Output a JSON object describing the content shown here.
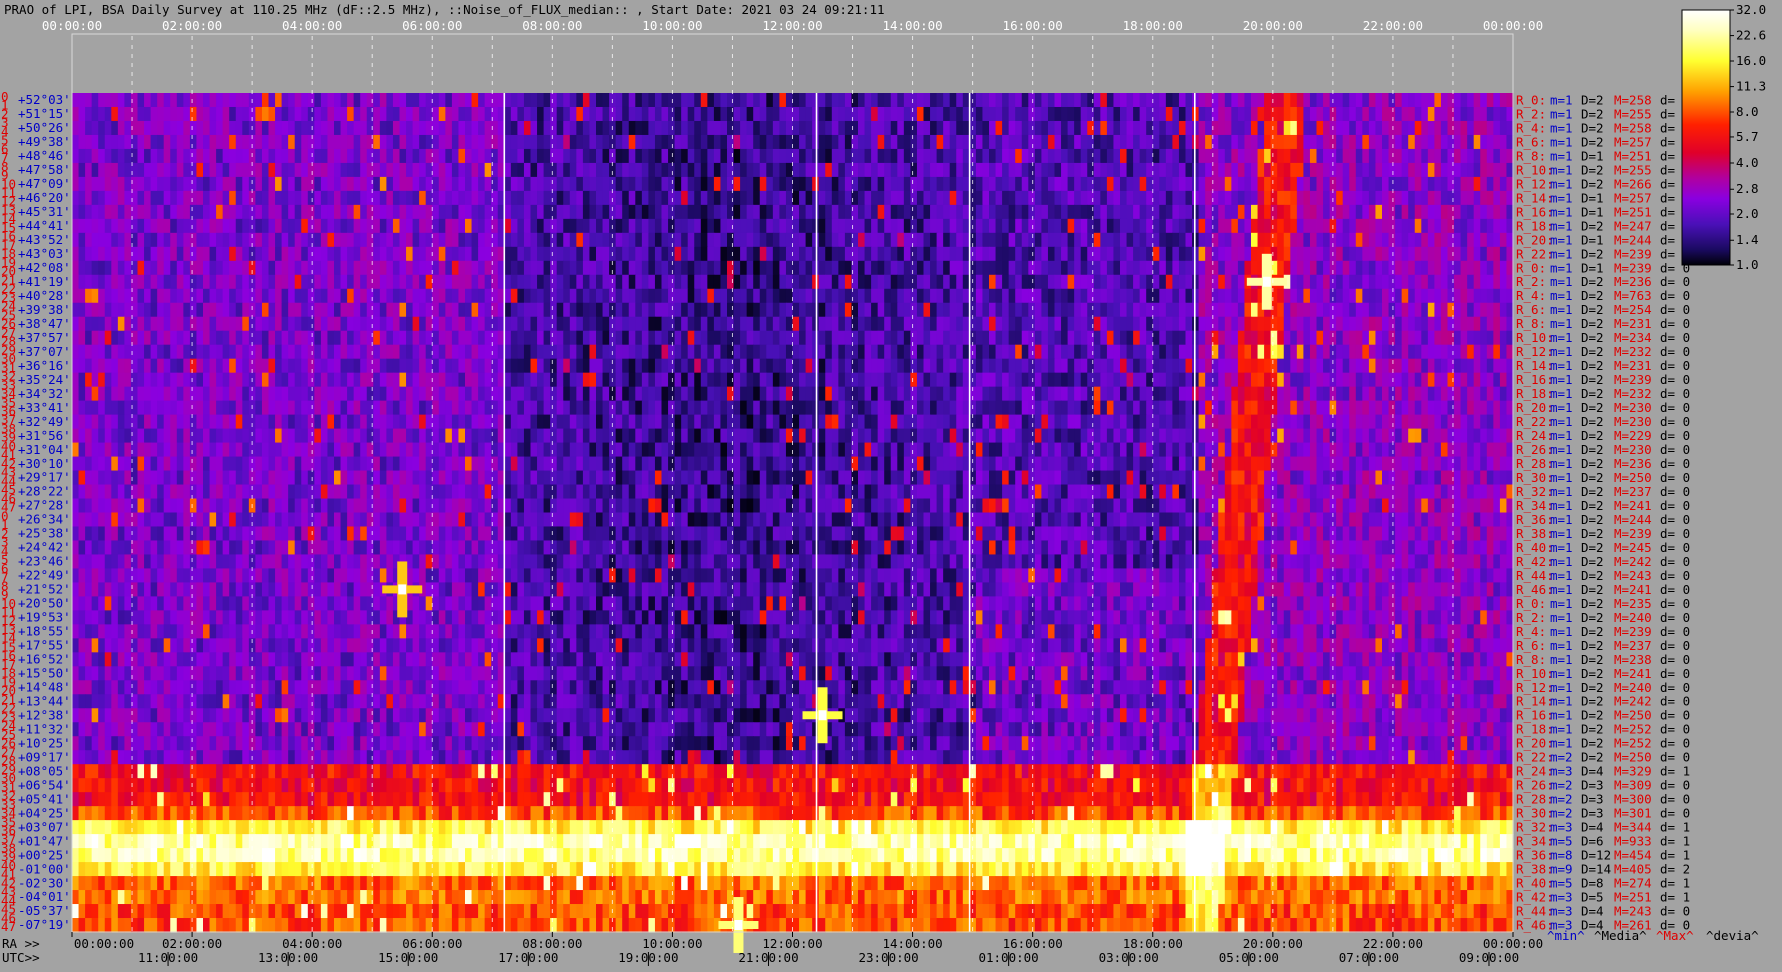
{
  "title": "PRAO of LPI, BSA Daily Survey at 110.25 MHz (dF::2.5 MHz), ::Noise_of_FLUX_median:: , Start Date: 2021 03 24 09:21:11",
  "colors": {
    "background": "#a3a3a3",
    "row_labels": "#e00000",
    "stat_values": "#0000c8",
    "text": "#000000",
    "guide": "#ffffff"
  },
  "chart_data": {
    "type": "heatmap",
    "title": "PRAO of LPI, BSA Daily Survey at 110.25 MHz (dF::2.5 MHz), ::Noise_of_FLUX_median:: , Start Date: 2021 03 24 09:21:11",
    "top_axis_ticks": [
      "00:00:00",
      "02:00:00",
      "04:00:00",
      "06:00:00",
      "08:00:00",
      "10:00:00",
      "12:00:00",
      "14:00:00",
      "16:00:00",
      "18:00:00",
      "20:00:00",
      "22:00:00",
      "00:00:00"
    ],
    "bottom_axis": {
      "ra_label": "RA >>",
      "ra_ticks": [
        "00:00:00",
        "02:00:00",
        "04:00:00",
        "06:00:00",
        "08:00:00",
        "10:00:00",
        "12:00:00",
        "14:00:00",
        "16:00:00",
        "18:00:00",
        "20:00:00",
        "22:00:00",
        "00:00:00"
      ],
      "utc_label": "UTC>>",
      "utc_ticks": [
        "11:00:00",
        "13:00:00",
        "15:00:00",
        "17:00:00",
        "19:00:00",
        "21:00:00",
        "23:00:00",
        "01:00:00",
        "03:00:00",
        "05:00:00",
        "07:00:00",
        "09:00:00"
      ]
    },
    "ra_range_hours": [
      0,
      24
    ],
    "declination_labels": [
      "+52°03'",
      "+51°15'",
      "+50°26'",
      "+49°38'",
      "+48°46'",
      "+47°58'",
      "+47°09'",
      "+46°20'",
      "+45°31'",
      "+44°41'",
      "+43°52'",
      "+43°03'",
      "+42°08'",
      "+41°19'",
      "+40°28'",
      "+39°38'",
      "+38°47'",
      "+37°57'",
      "+37°07'",
      "+36°16'",
      "+35°24'",
      "+34°32'",
      "+33°41'",
      "+32°49'",
      "+31°56'",
      "+31°04'",
      "+30°10'",
      "+29°17'",
      "+28°22'",
      "+27°28'",
      "+26°34'",
      "+25°38'",
      "+24°42'",
      "+23°46'",
      "+22°49'",
      "+21°52'",
      "+20°50'",
      "+19°53'",
      "+18°55'",
      "+17°55'",
      "+16°52'",
      "+15°50'",
      "+14°48'",
      "+13°44'",
      "+12°38'",
      "+11°32'",
      "+10°25'",
      "+09°17'",
      "+08°05'",
      "+06°54'",
      "+05°41'",
      "+04°25'",
      "+03°07'",
      "+01°47'",
      "+00°25'",
      "-01°00'",
      "-02°30'",
      "-04°01'",
      "-05°37'",
      "-07°19'"
    ],
    "row_index_labels": [
      "0",
      "1",
      "2",
      "3",
      "4",
      "5",
      "6",
      "7",
      "8",
      "9",
      "10",
      "11",
      "12",
      "13",
      "14",
      "15",
      "16",
      "17",
      "18",
      "19",
      "20",
      "21",
      "22",
      "23",
      "24",
      "25",
      "26",
      "27",
      "28",
      "29",
      "30",
      "31",
      "32",
      "33",
      "34",
      "35",
      "36",
      "37",
      "38",
      "39",
      "40",
      "41",
      "42",
      "43",
      "44",
      "45",
      "46",
      "47",
      "0",
      "1",
      "2",
      "3",
      "4",
      "5",
      "6",
      "7",
      "8",
      "9",
      "10",
      "11",
      "12",
      "13",
      "14",
      "15",
      "16",
      "17",
      "18",
      "19",
      "20",
      "21",
      "22",
      "23",
      "24",
      "25",
      "26",
      "27",
      "28",
      "29",
      "30",
      "31",
      "32",
      "33",
      "34",
      "35",
      "36",
      "37",
      "38",
      "39",
      "40",
      "41",
      "42",
      "43",
      "44",
      "45",
      "46",
      "47"
    ],
    "colorbar": {
      "ticks": [
        32.0,
        22.6,
        16.0,
        11.3,
        8.0,
        5.7,
        4.0,
        2.8,
        2.0,
        1.4,
        1.0
      ],
      "tick_labels": [
        "32.0",
        "22.6",
        "16.0",
        "11.3",
        "8.0",
        "5.7",
        "4.0",
        "2.8",
        "2.0",
        "1.4",
        "1.0"
      ],
      "scale": "log",
      "range": [
        1.0,
        32.0
      ]
    },
    "stats_legend": [
      "^min^",
      "^Media^",
      "^Max^",
      "^devia^"
    ],
    "stats_rows": [
      {
        "r": "R_0:",
        "m": "m=1",
        "d": "D=2",
        "M": "M=258",
        "dv": "d= 0"
      },
      {
        "r": "R_2:",
        "m": "m=1",
        "d": "D=2",
        "M": "M=255",
        "dv": "d= 0"
      },
      {
        "r": "R_4:",
        "m": "m=1",
        "d": "D=2",
        "M": "M=258",
        "dv": "d= 0"
      },
      {
        "r": "R_6:",
        "m": "m=1",
        "d": "D=2",
        "M": "M=257",
        "dv": "d= 0"
      },
      {
        "r": "R_8:",
        "m": "m=1",
        "d": "D=1",
        "M": "M=251",
        "dv": "d= 0"
      },
      {
        "r": "R_10:",
        "m": "m=1",
        "d": "D=2",
        "M": "M=255",
        "dv": "d="
      },
      {
        "r": "R_12:",
        "m": "m=1",
        "d": "D=2",
        "M": "M=266",
        "dv": "d="
      },
      {
        "r": "R_14:",
        "m": "m=1",
        "d": "D=1",
        "M": "M=257",
        "dv": "d="
      },
      {
        "r": "R_16:",
        "m": "m=1",
        "d": "D=1",
        "M": "M=251",
        "dv": "d="
      },
      {
        "r": "R_18:",
        "m": "m=1",
        "d": "D=2",
        "M": "M=247",
        "dv": "d="
      },
      {
        "r": "R_20:",
        "m": "m=1",
        "d": "D=1",
        "M": "M=244",
        "dv": "d="
      },
      {
        "r": "R_22:",
        "m": "m=1",
        "d": "D=2",
        "M": "M=239",
        "dv": "d="
      },
      {
        "r": "R_0:",
        "m": "m=1",
        "d": "D=1",
        "M": "M=239",
        "dv": "d= 0"
      },
      {
        "r": "R_2:",
        "m": "m=1",
        "d": "D=2",
        "M": "M=236",
        "dv": "d= 0"
      },
      {
        "r": "R_4:",
        "m": "m=1",
        "d": "D=2",
        "M": "M=763",
        "dv": "d= 0"
      },
      {
        "r": "R_6:",
        "m": "m=1",
        "d": "D=2",
        "M": "M=254",
        "dv": "d= 0"
      },
      {
        "r": "R_8:",
        "m": "m=1",
        "d": "D=2",
        "M": "M=231",
        "dv": "d= 0"
      },
      {
        "r": "R_10:",
        "m": "m=1",
        "d": "D=2",
        "M": "M=234",
        "dv": "d= 0"
      },
      {
        "r": "R_12:",
        "m": "m=1",
        "d": "D=2",
        "M": "M=232",
        "dv": "d= 0"
      },
      {
        "r": "R_14:",
        "m": "m=1",
        "d": "D=2",
        "M": "M=231",
        "dv": "d= 0"
      },
      {
        "r": "R_16:",
        "m": "m=1",
        "d": "D=2",
        "M": "M=239",
        "dv": "d= 0"
      },
      {
        "r": "R_18:",
        "m": "m=1",
        "d": "D=2",
        "M": "M=232",
        "dv": "d= 0"
      },
      {
        "r": "R_20:",
        "m": "m=1",
        "d": "D=2",
        "M": "M=230",
        "dv": "d= 0"
      },
      {
        "r": "R_22:",
        "m": "m=1",
        "d": "D=2",
        "M": "M=230",
        "dv": "d= 0"
      },
      {
        "r": "R_24:",
        "m": "m=1",
        "d": "D=2",
        "M": "M=229",
        "dv": "d= 0"
      },
      {
        "r": "R_26:",
        "m": "m=1",
        "d": "D=2",
        "M": "M=230",
        "dv": "d= 0"
      },
      {
        "r": "R_28:",
        "m": "m=1",
        "d": "D=2",
        "M": "M=236",
        "dv": "d= 0"
      },
      {
        "r": "R_30:",
        "m": "m=1",
        "d": "D=2",
        "M": "M=250",
        "dv": "d= 0"
      },
      {
        "r": "R_32:",
        "m": "m=1",
        "d": "D=2",
        "M": "M=237",
        "dv": "d= 0"
      },
      {
        "r": "R_34:",
        "m": "m=1",
        "d": "D=2",
        "M": "M=241",
        "dv": "d= 0"
      },
      {
        "r": "R_36:",
        "m": "m=1",
        "d": "D=2",
        "M": "M=244",
        "dv": "d= 0"
      },
      {
        "r": "R_38:",
        "m": "m=1",
        "d": "D=2",
        "M": "M=239",
        "dv": "d= 0"
      },
      {
        "r": "R_40:",
        "m": "m=1",
        "d": "D=2",
        "M": "M=245",
        "dv": "d= 0"
      },
      {
        "r": "R_42:",
        "m": "m=1",
        "d": "D=2",
        "M": "M=242",
        "dv": "d= 0"
      },
      {
        "r": "R_44:",
        "m": "m=1",
        "d": "D=2",
        "M": "M=243",
        "dv": "d= 0"
      },
      {
        "r": "R_46:",
        "m": "m=1",
        "d": "D=2",
        "M": "M=241",
        "dv": "d= 0"
      },
      {
        "r": "R_0:",
        "m": "m=1",
        "d": "D=2",
        "M": "M=235",
        "dv": "d= 0"
      },
      {
        "r": "R_2:",
        "m": "m=1",
        "d": "D=2",
        "M": "M=240",
        "dv": "d= 0"
      },
      {
        "r": "R_4:",
        "m": "m=1",
        "d": "D=2",
        "M": "M=239",
        "dv": "d= 0"
      },
      {
        "r": "R_6:",
        "m": "m=1",
        "d": "D=2",
        "M": "M=237",
        "dv": "d= 0"
      },
      {
        "r": "R_8:",
        "m": "m=1",
        "d": "D=2",
        "M": "M=238",
        "dv": "d= 0"
      },
      {
        "r": "R_10:",
        "m": "m=1",
        "d": "D=2",
        "M": "M=241",
        "dv": "d= 0"
      },
      {
        "r": "R_12:",
        "m": "m=1",
        "d": "D=2",
        "M": "M=240",
        "dv": "d= 0"
      },
      {
        "r": "R_14:",
        "m": "m=1",
        "d": "D=2",
        "M": "M=242",
        "dv": "d= 0"
      },
      {
        "r": "R_16:",
        "m": "m=1",
        "d": "D=2",
        "M": "M=250",
        "dv": "d= 0"
      },
      {
        "r": "R_18:",
        "m": "m=1",
        "d": "D=2",
        "M": "M=252",
        "dv": "d= 0"
      },
      {
        "r": "R_20:",
        "m": "m=1",
        "d": "D=2",
        "M": "M=252",
        "dv": "d= 0"
      },
      {
        "r": "R_22:",
        "m": "m=2",
        "d": "D=2",
        "M": "M=250",
        "dv": "d= 0"
      },
      {
        "r": "R_24:",
        "m": "m=3",
        "d": "D=4",
        "M": "M=329",
        "dv": "d= 1"
      },
      {
        "r": "R_26:",
        "m": "m=2",
        "d": "D=3",
        "M": "M=309",
        "dv": "d= 0"
      },
      {
        "r": "R_28:",
        "m": "m=2",
        "d": "D=3",
        "M": "M=300",
        "dv": "d= 0"
      },
      {
        "r": "R_30:",
        "m": "m=2",
        "d": "D=3",
        "M": "M=301",
        "dv": "d= 0"
      },
      {
        "r": "R_32:",
        "m": "m=3",
        "d": "D=4",
        "M": "M=344",
        "dv": "d= 1"
      },
      {
        "r": "R_34:",
        "m": "m=5",
        "d": "D=6",
        "M": "M=933",
        "dv": "d= 1"
      },
      {
        "r": "R_36:",
        "m": "m=8",
        "d": "D=12",
        "M": "M=454",
        "dv": "d= 1"
      },
      {
        "r": "R_38:",
        "m": "m=9",
        "d": "D=14",
        "M": "M=405",
        "dv": "d= 2"
      },
      {
        "r": "R_40:",
        "m": "m=5",
        "d": "D=8",
        "M": "M=274",
        "dv": "d= 1"
      },
      {
        "r": "R_42:",
        "m": "m=3",
        "d": "D=5",
        "M": "M=251",
        "dv": "d= 1"
      },
      {
        "r": "R_44:",
        "m": "m=3",
        "d": "D=4",
        "M": "M=243",
        "dv": "d= 0"
      },
      {
        "r": "R_46:",
        "m": "m=3",
        "d": "D=4",
        "M": "M=261",
        "dv": "d= 0"
      }
    ],
    "bright_sources": [
      {
        "ra_h": 19.9,
        "dec": 41.0,
        "flux": 32
      },
      {
        "ra_h": 11.1,
        "dec": -7.5,
        "flux": 28
      },
      {
        "ra_h": 12.5,
        "dec": 12.5,
        "flux": 24
      },
      {
        "ra_h": 5.5,
        "dec": 21.5,
        "flux": 18
      }
    ]
  }
}
